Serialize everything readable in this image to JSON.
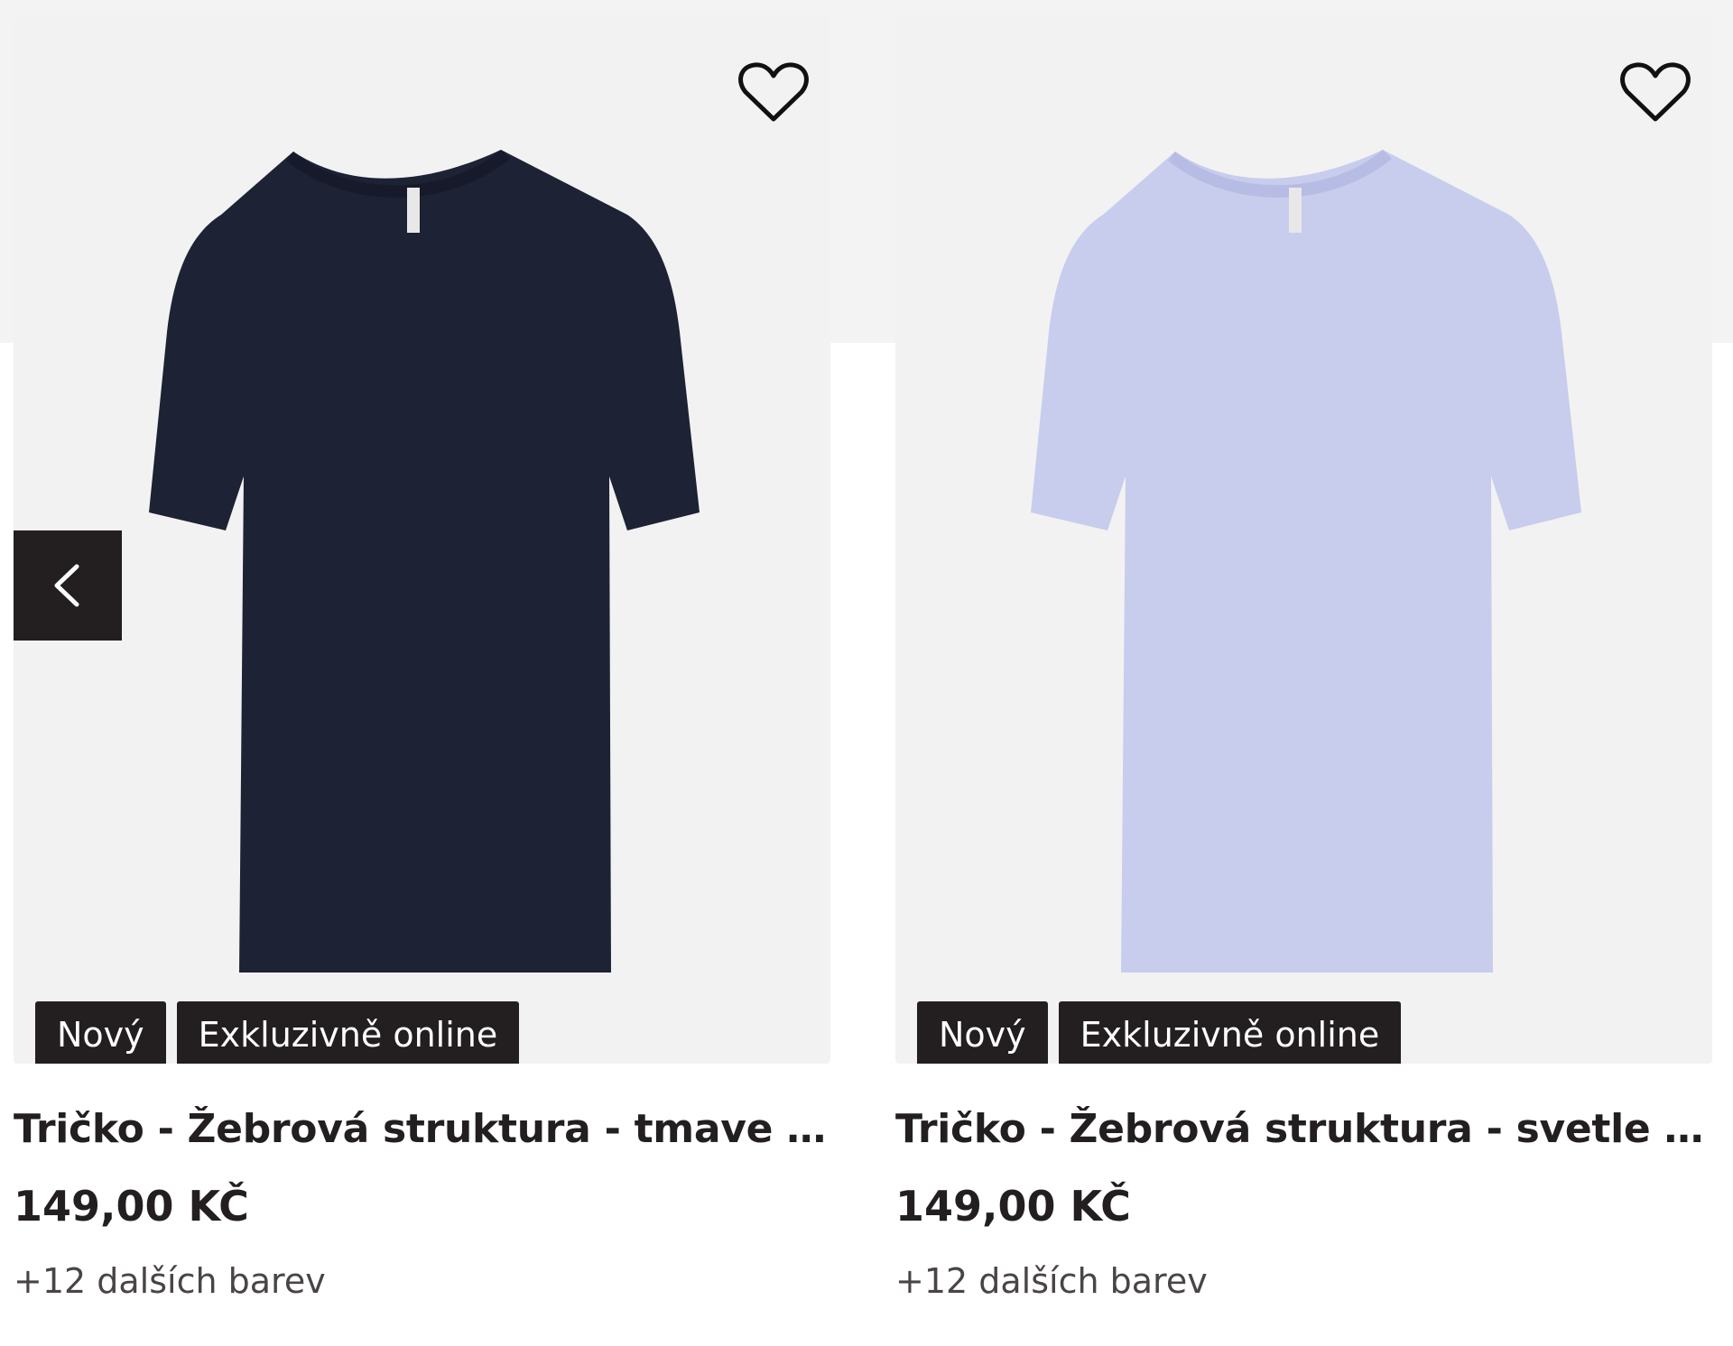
{
  "products": [
    {
      "title": "Tričko - Žebrová struktura - tmave mo...",
      "price": "149,00 KČ",
      "more_colors": "+12 dalších barev",
      "badges": [
        "Nový",
        "Exkluzivně online"
      ],
      "shirt_color": "#1d2235",
      "shirt_shade": "#161a2a"
    },
    {
      "title": "Tričko - Žebrová struktura - svetle mo...",
      "price": "149,00 KČ",
      "more_colors": "+12 dalších barev",
      "badges": [
        "Nový",
        "Exkluzivně online"
      ],
      "shirt_color": "#c8cdee",
      "shirt_shade": "#b6bce3"
    }
  ],
  "icons": {
    "wishlist": "heart-outline-icon",
    "carousel_prev": "chevron-left-icon"
  },
  "colors": {
    "badge_bg": "#231f20",
    "image_bg": "#f2f2f2"
  }
}
